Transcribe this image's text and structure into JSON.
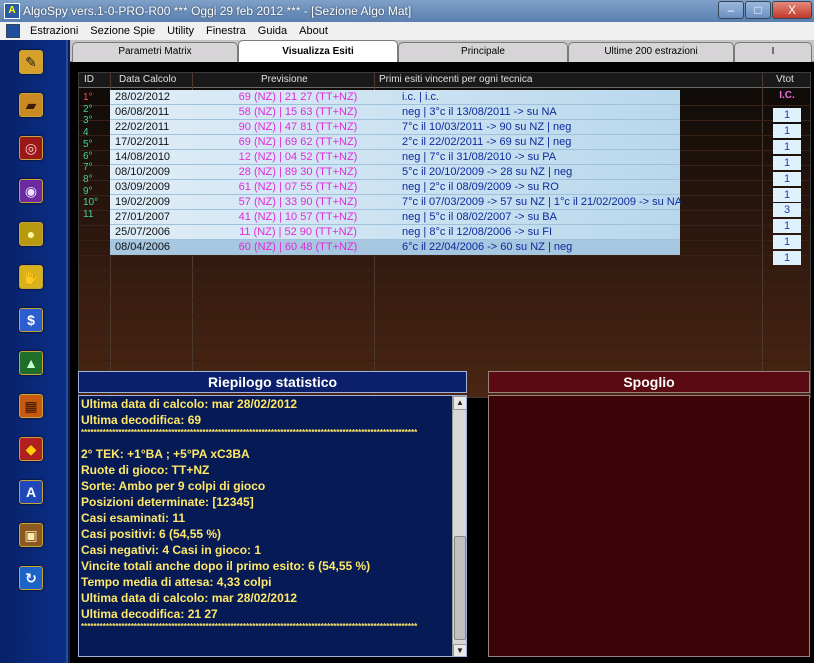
{
  "window": {
    "title": "AlgoSpy vers.1-0-PRO-R00  ***  Oggi 29 feb 2012  ***   - [Sezione Algo Mat]",
    "controls": [
      "–",
      "□",
      "X"
    ]
  },
  "menu": [
    "Estrazioni",
    "Sezione Spie",
    "Utility",
    "Finestra",
    "Guida",
    "About"
  ],
  "tabs": [
    {
      "label": "Parametri Matrix",
      "active": false
    },
    {
      "label": "Visualizza Esiti",
      "active": true
    },
    {
      "label": "Principale",
      "active": false
    },
    {
      "label": "Ultime 200 estrazioni",
      "active": false
    },
    {
      "label": "I",
      "active": false
    }
  ],
  "grid": {
    "headers": {
      "id": "ID",
      "date": "Data Calcolo",
      "prev": "Previsione",
      "esiti": "Primi esiti vincenti per ogni tecnica",
      "vtot": "Vtot"
    },
    "vtot_head": "I.C.",
    "ids": [
      "1°",
      "2°",
      "3°",
      "4",
      "5°",
      "6°",
      "7°",
      "8°",
      "9°",
      "10°",
      "11"
    ],
    "rows": [
      {
        "date": "28/02/2012",
        "prev": "69 (NZ) | 21 27 (TT+NZ)",
        "esiti": "i.c. | i.c."
      },
      {
        "date": "06/08/2011",
        "prev": "58 (NZ) | 15 63 (TT+NZ)",
        "esiti": "neg | 3°c il 13/08/2011 -> su NA"
      },
      {
        "date": "22/02/2011",
        "prev": "90 (NZ) | 47 81 (TT+NZ)",
        "esiti": "7°c il 10/03/2011 -> 90 su NZ | neg"
      },
      {
        "date": "17/02/2011",
        "prev": "69 (NZ) | 69 62 (TT+NZ)",
        "esiti": "2°c il 22/02/2011 -> 69 su NZ | neg"
      },
      {
        "date": "14/08/2010",
        "prev": "12 (NZ) | 04 52 (TT+NZ)",
        "esiti": "neg | 7°c il 31/08/2010 -> su PA"
      },
      {
        "date": "08/10/2009",
        "prev": "28 (NZ) | 89 30 (TT+NZ)",
        "esiti": "5°c il 20/10/2009 -> 28 su NZ | neg"
      },
      {
        "date": "03/09/2009",
        "prev": "61 (NZ) | 07 55 (TT+NZ)",
        "esiti": "neg | 2°c il 08/09/2009 -> su RO"
      },
      {
        "date": "19/02/2009",
        "prev": "57 (NZ) | 33 90 (TT+NZ)",
        "esiti": "7°c il 07/03/2009 -> 57 su NZ | 1°c il 21/02/2009 -> su NA"
      },
      {
        "date": "27/01/2007",
        "prev": "41 (NZ) | 10 57 (TT+NZ)",
        "esiti": "neg | 5°c il 08/02/2007 -> su BA"
      },
      {
        "date": "25/07/2006",
        "prev": "11 (NZ) | 52 90 (TT+NZ)",
        "esiti": "neg | 8°c il 12/08/2006 -> su FI"
      },
      {
        "date": "08/04/2006",
        "prev": "60 (NZ) | 60 48 (TT+NZ)",
        "esiti": "6°c il 22/04/2006 -> 60 su NZ | neg"
      }
    ],
    "vtot": [
      "1",
      "1",
      "1",
      "1",
      "1",
      "1",
      "3",
      "1",
      "1",
      "1"
    ]
  },
  "riepilogo": {
    "title": "Riepilogo statistico",
    "lines": [
      {
        "t": "Ultima data di calcolo: mar 28/02/2012",
        "k": "text"
      },
      {
        "t": "Ultima decodifica: 69",
        "k": "text"
      },
      {
        "t": "************************************************************************************************************",
        "k": "stars"
      },
      {
        "t": "",
        "k": "blank"
      },
      {
        "t": "2° TEK: +1°BA ; +5°PA xC3BA",
        "k": "text"
      },
      {
        "t": "Ruote di gioco: TT+NZ",
        "k": "text"
      },
      {
        "t": "Sorte: Ambo per 9 colpi di gioco",
        "k": "text"
      },
      {
        "t": "Posizioni determinate: [12345]",
        "k": "text"
      },
      {
        "t": "Casi esaminati: 11",
        "k": "text"
      },
      {
        "t": "Casi positivi: 6 (54,55 %)",
        "k": "text"
      },
      {
        "t": "Casi negativi: 4  Casi in gioco: 1",
        "k": "text"
      },
      {
        "t": "Vincite totali anche dopo il primo esito: 6 (54,55 %)",
        "k": "text"
      },
      {
        "t": "Tempo media di attesa: 4,33 colpi",
        "k": "text"
      },
      {
        "t": "Ultima data di calcolo: mar 28/02/2012",
        "k": "text"
      },
      {
        "t": "Ultima decodifica: 21 27",
        "k": "text"
      },
      {
        "t": "************************************************************************************************************",
        "k": "stars"
      }
    ]
  },
  "spoglio": {
    "title": "Spoglio"
  },
  "toolbar_icons": [
    {
      "name": "pencil-icon",
      "glyph": "✎",
      "bg": "#d7a02a",
      "fg": "#1a1a1a"
    },
    {
      "name": "books-icon",
      "glyph": "▰",
      "bg": "#c98a23",
      "fg": "#3a1b05"
    },
    {
      "name": "compass-icon",
      "glyph": "◎",
      "bg": "#9a1818",
      "fg": "#ffd0d0"
    },
    {
      "name": "telescope-icon",
      "glyph": "◉",
      "bg": "#6b2aa0",
      "fg": "#f0e0ff"
    },
    {
      "name": "lightbulb-icon",
      "glyph": "●",
      "bg": "#b79a10",
      "fg": "#fff7a0"
    },
    {
      "name": "hand-icon",
      "glyph": "✋",
      "bg": "#d8b21b",
      "fg": "#3a2600"
    },
    {
      "name": "dollar-icon",
      "glyph": "$",
      "bg": "#2b5fd0",
      "fg": "#ffffff"
    },
    {
      "name": "pyramid-icon",
      "glyph": "▲",
      "bg": "#1d6f2a",
      "fg": "#c8ffcf"
    },
    {
      "name": "calendar-icon",
      "glyph": "▦",
      "bg": "#c85a10",
      "fg": "#3a1500"
    },
    {
      "name": "diamond-icon",
      "glyph": "◆",
      "bg": "#b02020",
      "fg": "#ffd000"
    },
    {
      "name": "letter-a-icon",
      "glyph": "A",
      "bg": "#1f48b8",
      "fg": "#ffffff"
    },
    {
      "name": "book-icon",
      "glyph": "▣",
      "bg": "#8a5a20",
      "fg": "#ffe7b0"
    },
    {
      "name": "refresh-icon",
      "glyph": "↻",
      "bg": "#1d64c8",
      "fg": "#ffffff"
    }
  ]
}
